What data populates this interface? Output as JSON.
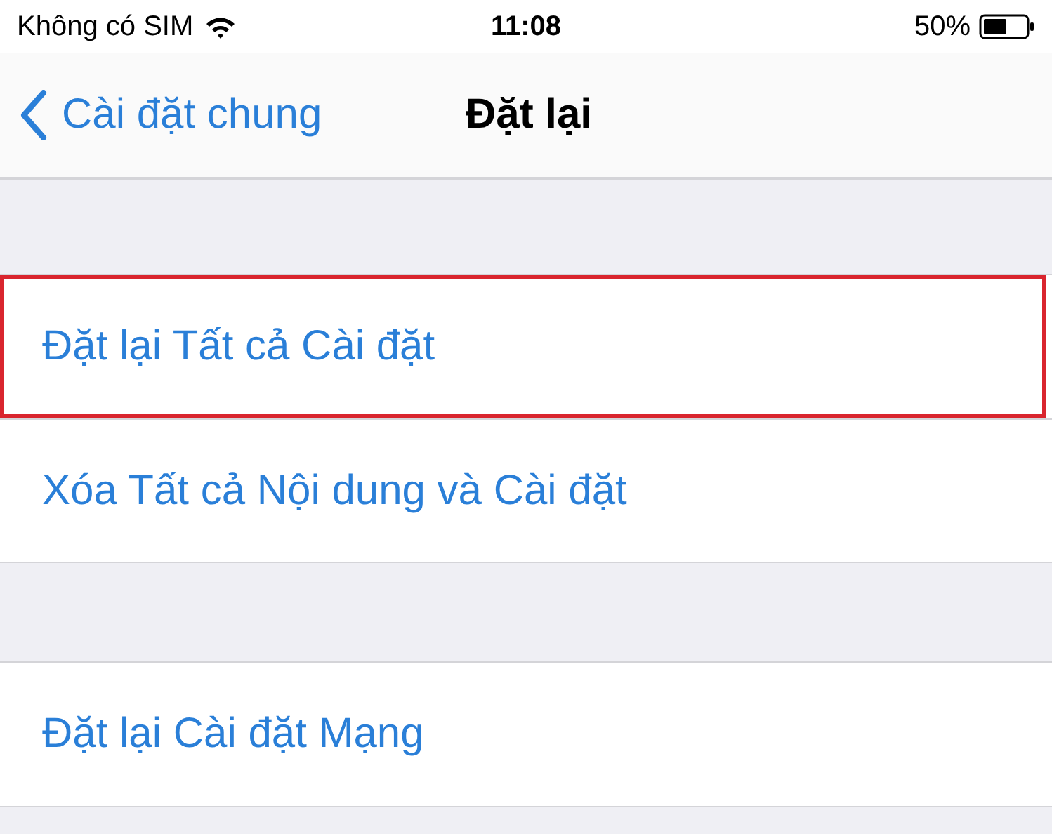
{
  "status_bar": {
    "carrier": "Không có SIM",
    "time": "11:08",
    "battery": "50%"
  },
  "nav": {
    "back": "Cài đặt chung",
    "title": "Đặt lại"
  },
  "groups": [
    {
      "rows": [
        {
          "label": "Đặt lại Tất cả Cài đặt",
          "highlighted": true
        },
        {
          "label": "Xóa Tất cả Nội dung và Cài đặt",
          "highlighted": false
        }
      ]
    },
    {
      "rows": [
        {
          "label": "Đặt lại Cài đặt Mạng",
          "highlighted": false
        }
      ]
    }
  ]
}
